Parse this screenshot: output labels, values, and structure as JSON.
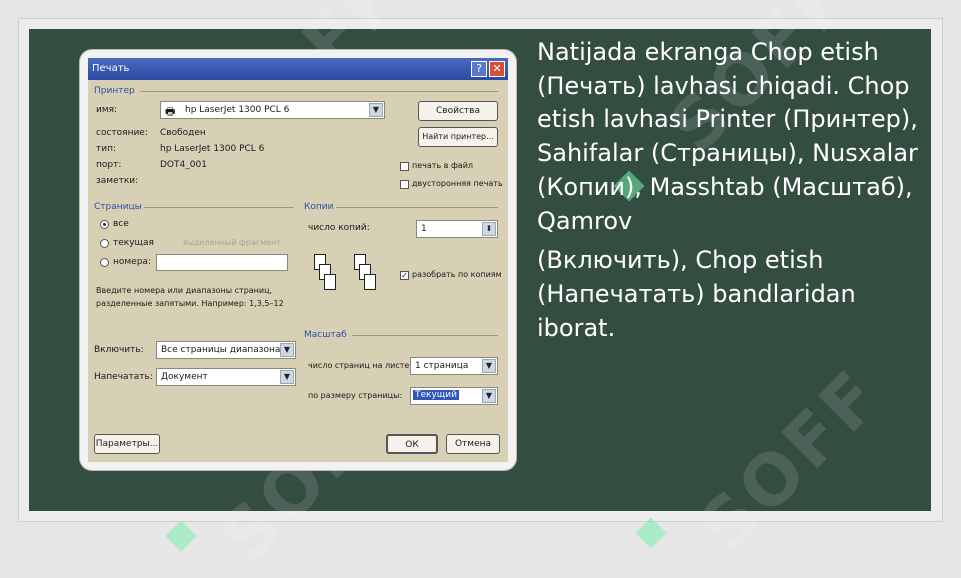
{
  "slide": {
    "paragraph1": "Natijada ekranga Chop etish (Печать) lavhasi chiqadi. Chop etish lavhasi Printer (Принтер), Sahifalar (Страницы), Nusxalar (Копии), Masshtab (Масштаб), Qamrov",
    "paragraph2": "(Включить), Chop etish (Напечатать) bandlaridan iborat."
  },
  "watermark": "SOFF",
  "dialog": {
    "title": "Печать",
    "help_glyph": "?",
    "close_glyph": "✕",
    "printer": {
      "group_label": "Принтер",
      "name_label": "имя:",
      "name_value": "hp LaserJet 1300 PCL 6",
      "properties_button": "Свойства",
      "find_printer_button": "Найти принтер...",
      "status_label": "состояние:",
      "status_value": "Свободен",
      "type_label": "тип:",
      "type_value": "hp LaserJet 1300 PCL 6",
      "port_label": "порт:",
      "port_value": "DOT4_001",
      "notes_label": "заметки:",
      "print_to_file": "печать в файл",
      "duplex": "двусторонняя печать"
    },
    "pages": {
      "group_label": "Страницы",
      "all": "все",
      "current": "текущая",
      "selection_disabled": "выделенный фрагмент",
      "numbers": "номера:",
      "hint": "Введите номера или диапазоны страниц, разделенные запятыми. Например: 1,3,5–12"
    },
    "copies": {
      "group_label": "Копии",
      "count_label": "число копий:",
      "count_value": "1",
      "collate": "разобрать по копиям",
      "collate_checked": "✓"
    },
    "include_label": "Включить:",
    "include_value": "Все страницы диапазона",
    "print_what_label": "Напечатать:",
    "print_what_value": "Документ",
    "zoom": {
      "group_label": "Масштаб",
      "pages_per_sheet_label": "число страниц на листе:",
      "pages_per_sheet_value": "1 страница",
      "scale_to_label": "по размеру страницы:",
      "scale_to_value": "Текущий"
    },
    "options_button": "Параметры...",
    "ok_button": "ОК",
    "cancel_button": "Отмена",
    "arrow_glyph": "▼",
    "spin_glyph": "⬍",
    "printer_icon_glyph": "🖶"
  }
}
